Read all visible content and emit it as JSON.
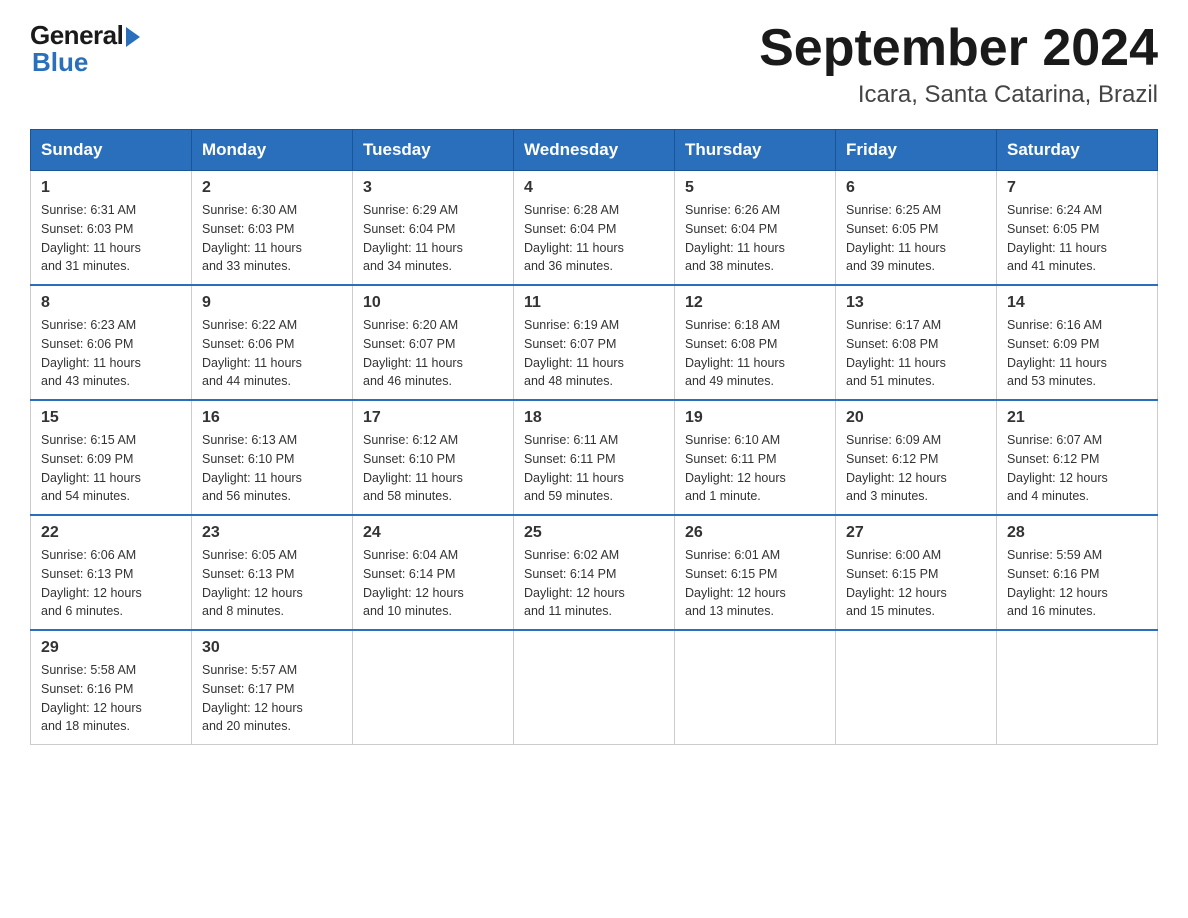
{
  "logo": {
    "general": "General",
    "blue": "Blue"
  },
  "title": "September 2024",
  "location": "Icara, Santa Catarina, Brazil",
  "days_of_week": [
    "Sunday",
    "Monday",
    "Tuesday",
    "Wednesday",
    "Thursday",
    "Friday",
    "Saturday"
  ],
  "weeks": [
    [
      {
        "day": "1",
        "sunrise": "6:31 AM",
        "sunset": "6:03 PM",
        "daylight": "11 hours and 31 minutes."
      },
      {
        "day": "2",
        "sunrise": "6:30 AM",
        "sunset": "6:03 PM",
        "daylight": "11 hours and 33 minutes."
      },
      {
        "day": "3",
        "sunrise": "6:29 AM",
        "sunset": "6:04 PM",
        "daylight": "11 hours and 34 minutes."
      },
      {
        "day": "4",
        "sunrise": "6:28 AM",
        "sunset": "6:04 PM",
        "daylight": "11 hours and 36 minutes."
      },
      {
        "day": "5",
        "sunrise": "6:26 AM",
        "sunset": "6:04 PM",
        "daylight": "11 hours and 38 minutes."
      },
      {
        "day": "6",
        "sunrise": "6:25 AM",
        "sunset": "6:05 PM",
        "daylight": "11 hours and 39 minutes."
      },
      {
        "day": "7",
        "sunrise": "6:24 AM",
        "sunset": "6:05 PM",
        "daylight": "11 hours and 41 minutes."
      }
    ],
    [
      {
        "day": "8",
        "sunrise": "6:23 AM",
        "sunset": "6:06 PM",
        "daylight": "11 hours and 43 minutes."
      },
      {
        "day": "9",
        "sunrise": "6:22 AM",
        "sunset": "6:06 PM",
        "daylight": "11 hours and 44 minutes."
      },
      {
        "day": "10",
        "sunrise": "6:20 AM",
        "sunset": "6:07 PM",
        "daylight": "11 hours and 46 minutes."
      },
      {
        "day": "11",
        "sunrise": "6:19 AM",
        "sunset": "6:07 PM",
        "daylight": "11 hours and 48 minutes."
      },
      {
        "day": "12",
        "sunrise": "6:18 AM",
        "sunset": "6:08 PM",
        "daylight": "11 hours and 49 minutes."
      },
      {
        "day": "13",
        "sunrise": "6:17 AM",
        "sunset": "6:08 PM",
        "daylight": "11 hours and 51 minutes."
      },
      {
        "day": "14",
        "sunrise": "6:16 AM",
        "sunset": "6:09 PM",
        "daylight": "11 hours and 53 minutes."
      }
    ],
    [
      {
        "day": "15",
        "sunrise": "6:15 AM",
        "sunset": "6:09 PM",
        "daylight": "11 hours and 54 minutes."
      },
      {
        "day": "16",
        "sunrise": "6:13 AM",
        "sunset": "6:10 PM",
        "daylight": "11 hours and 56 minutes."
      },
      {
        "day": "17",
        "sunrise": "6:12 AM",
        "sunset": "6:10 PM",
        "daylight": "11 hours and 58 minutes."
      },
      {
        "day": "18",
        "sunrise": "6:11 AM",
        "sunset": "6:11 PM",
        "daylight": "11 hours and 59 minutes."
      },
      {
        "day": "19",
        "sunrise": "6:10 AM",
        "sunset": "6:11 PM",
        "daylight": "12 hours and 1 minute."
      },
      {
        "day": "20",
        "sunrise": "6:09 AM",
        "sunset": "6:12 PM",
        "daylight": "12 hours and 3 minutes."
      },
      {
        "day": "21",
        "sunrise": "6:07 AM",
        "sunset": "6:12 PM",
        "daylight": "12 hours and 4 minutes."
      }
    ],
    [
      {
        "day": "22",
        "sunrise": "6:06 AM",
        "sunset": "6:13 PM",
        "daylight": "12 hours and 6 minutes."
      },
      {
        "day": "23",
        "sunrise": "6:05 AM",
        "sunset": "6:13 PM",
        "daylight": "12 hours and 8 minutes."
      },
      {
        "day": "24",
        "sunrise": "6:04 AM",
        "sunset": "6:14 PM",
        "daylight": "12 hours and 10 minutes."
      },
      {
        "day": "25",
        "sunrise": "6:02 AM",
        "sunset": "6:14 PM",
        "daylight": "12 hours and 11 minutes."
      },
      {
        "day": "26",
        "sunrise": "6:01 AM",
        "sunset": "6:15 PM",
        "daylight": "12 hours and 13 minutes."
      },
      {
        "day": "27",
        "sunrise": "6:00 AM",
        "sunset": "6:15 PM",
        "daylight": "12 hours and 15 minutes."
      },
      {
        "day": "28",
        "sunrise": "5:59 AM",
        "sunset": "6:16 PM",
        "daylight": "12 hours and 16 minutes."
      }
    ],
    [
      {
        "day": "29",
        "sunrise": "5:58 AM",
        "sunset": "6:16 PM",
        "daylight": "12 hours and 18 minutes."
      },
      {
        "day": "30",
        "sunrise": "5:57 AM",
        "sunset": "6:17 PM",
        "daylight": "12 hours and 20 minutes."
      },
      null,
      null,
      null,
      null,
      null
    ]
  ],
  "labels": {
    "sunrise": "Sunrise:",
    "sunset": "Sunset:",
    "daylight": "Daylight:"
  }
}
